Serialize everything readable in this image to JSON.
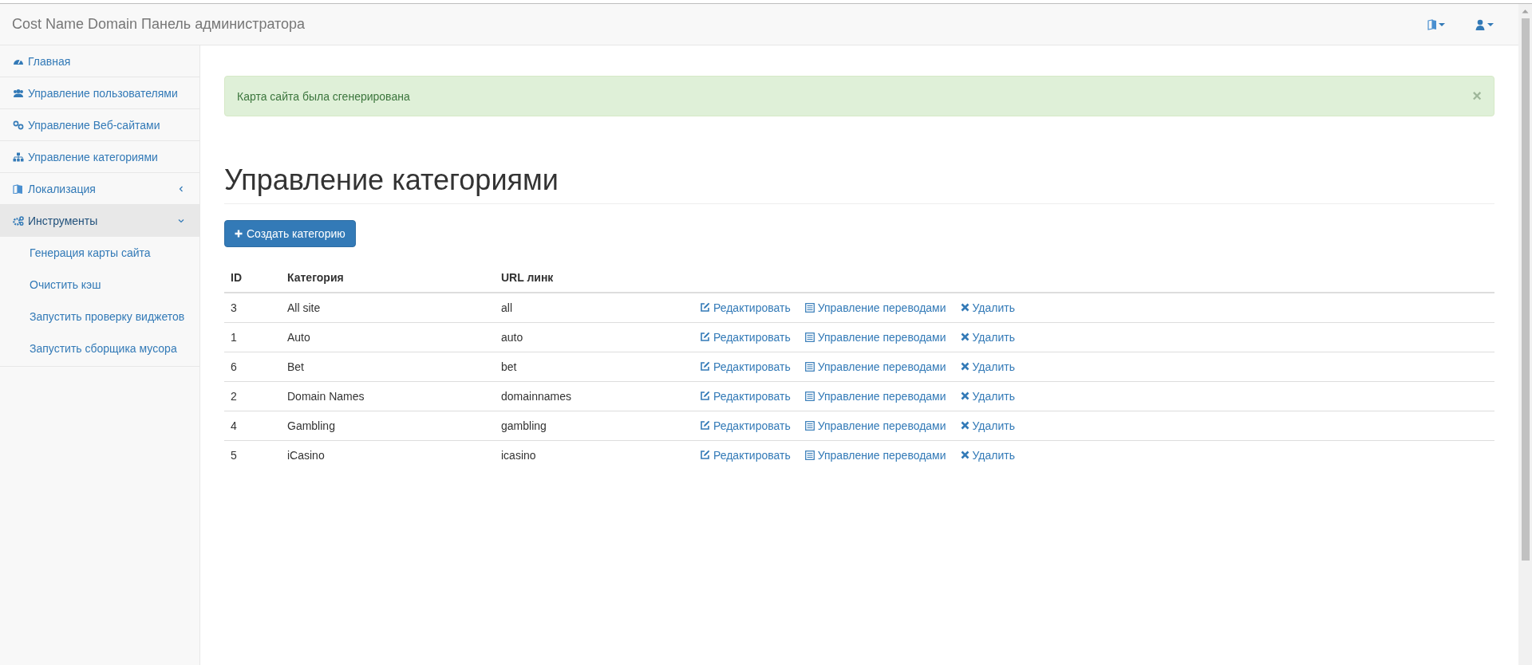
{
  "navbar": {
    "brand": "Cost Name Domain Панель администратора"
  },
  "sidebar": {
    "items": [
      {
        "label": "Главная",
        "selected": false
      },
      {
        "label": "Управление пользователями",
        "selected": false
      },
      {
        "label": "Управление Веб-сайтами",
        "selected": false
      },
      {
        "label": "Управление категориями",
        "selected": false
      },
      {
        "label": "Локализация",
        "selected": false,
        "expanded": false
      },
      {
        "label": "Инструменты",
        "selected": true,
        "expanded": true,
        "children": [
          {
            "label": "Генерация карты сайта"
          },
          {
            "label": "Очистить кэш"
          },
          {
            "label": "Запустить проверку виджетов"
          },
          {
            "label": "Запустить сборщика мусора"
          }
        ]
      }
    ]
  },
  "alert": {
    "message": "Карта сайта была сгенерирована",
    "close": "×"
  },
  "page_title": "Управление категориями",
  "create_button": "Создать категорию",
  "table": {
    "columns": [
      "ID",
      "Категория",
      "URL линк"
    ],
    "rows": [
      {
        "id": "3",
        "category": "All site",
        "url": "all",
        "actions": [
          "Редактировать",
          "Управление переводами",
          "Удалить"
        ]
      },
      {
        "id": "1",
        "category": "Auto",
        "url": "auto",
        "actions": [
          "Редактировать",
          "Управление переводами",
          "Удалить"
        ]
      },
      {
        "id": "6",
        "category": "Bet",
        "url": "bet",
        "actions": [
          "Редактировать",
          "Управление переводами",
          "Удалить"
        ]
      },
      {
        "id": "2",
        "category": "Domain Names",
        "url": "domainnames",
        "actions": [
          "Редактировать",
          "Управление переводами",
          "Удалить"
        ]
      },
      {
        "id": "4",
        "category": "Gambling",
        "url": "gambling",
        "actions": [
          "Редактировать",
          "Управление переводами",
          "Удалить"
        ]
      },
      {
        "id": "5",
        "category": "iCasino",
        "url": "icasino",
        "actions": [
          "Редактировать",
          "Управление переводами",
          "Удалить"
        ]
      }
    ]
  }
}
